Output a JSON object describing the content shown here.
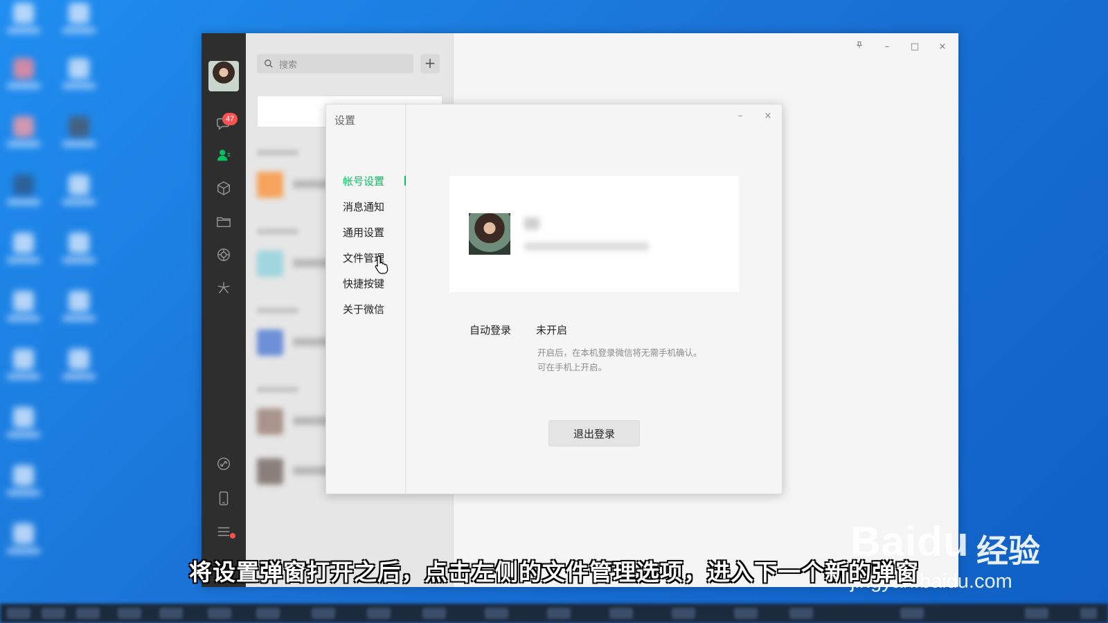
{
  "list": {
    "search_placeholder": "搜索",
    "add_label": "+"
  },
  "sidebar": {
    "unread_count": "47"
  },
  "window": {
    "pin_icon": "pin-icon",
    "minimize": "–",
    "maximize": "□",
    "close": "×"
  },
  "settings": {
    "title": "设置",
    "minimize": "–",
    "close": "×",
    "nav": [
      {
        "label": "帐号设置",
        "active": true
      },
      {
        "label": "消息通知",
        "active": false
      },
      {
        "label": "通用设置",
        "active": false
      },
      {
        "label": "文件管理",
        "active": false
      },
      {
        "label": "快捷按键",
        "active": false
      },
      {
        "label": "关于微信",
        "active": false
      }
    ],
    "auto_login_label": "自动登录",
    "auto_login_value": "未开启",
    "hint_line1": "开启后，在本机登录微信将无需手机确认。",
    "hint_line2": "可在手机上开启。",
    "logout_label": "退出登录"
  },
  "overlay": {
    "caption": "将设置弹窗打开之后，点击左侧的文件管理选项，进入下一个新的弹窗",
    "watermark_logo": "Baidu",
    "watermark_text": "经验",
    "watermark_url": "jingyan.baidu.com"
  },
  "colors": {
    "accent": "#07c160",
    "badge": "#fa5151",
    "sidebar": "#2e2e2e",
    "desktop": "#1a73d6"
  }
}
